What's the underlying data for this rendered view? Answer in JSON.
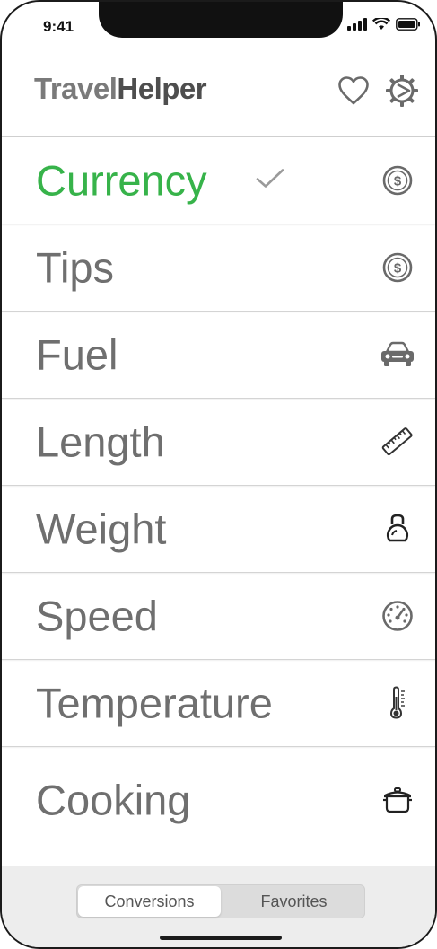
{
  "status_bar": {
    "time": "9:41"
  },
  "header": {
    "title_part1": "Travel",
    "title_part2": "Helper",
    "favorites_icon": "heart-icon",
    "settings_icon": "gear-icon"
  },
  "categories": [
    {
      "label": "Currency",
      "icon": "dollar-circle-icon",
      "selected": true
    },
    {
      "label": "Tips",
      "icon": "dollar-circle-icon"
    },
    {
      "label": "Fuel",
      "icon": "car-icon"
    },
    {
      "label": "Length",
      "icon": "ruler-icon"
    },
    {
      "label": "Weight",
      "icon": "kettlebell-icon"
    },
    {
      "label": "Speed",
      "icon": "speedometer-icon"
    },
    {
      "label": "Temperature",
      "icon": "thermometer-icon"
    },
    {
      "label": "Cooking",
      "icon": "pot-icon"
    }
  ],
  "tabs": {
    "conversions": "Conversions",
    "favorites": "Favorites",
    "selected": "conversions"
  },
  "colors": {
    "accent": "#37b34a",
    "text": "#6f6f6f"
  }
}
